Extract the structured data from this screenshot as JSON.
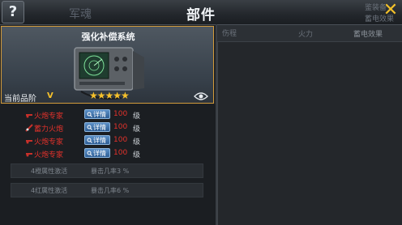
{
  "header": {
    "help_label": "?",
    "title": "部件",
    "close_label": "✕",
    "bg_text_left": "军魂",
    "bg_text_right_top": "鉴装备",
    "bg_text_right_bottom": "蓄电效果"
  },
  "bg_strip": {
    "t1": "伤程",
    "t2": "火力",
    "t3": "蓄电效果"
  },
  "card": {
    "title": "强化补偿系统",
    "grade_label": "当前品阶",
    "grade_value": "V",
    "stars": "★★★★★",
    "eye_icon": "eye-icon"
  },
  "parts": [
    {
      "icon": "cannon-icon",
      "name": "火炮专家",
      "detail": "详情",
      "level": "100",
      "unit": "级"
    },
    {
      "icon": "charge-cannon-icon",
      "name": "蓄力火炮",
      "detail": "详情",
      "level": "100",
      "unit": "级"
    },
    {
      "icon": "cannon-icon",
      "name": "火炮专家",
      "detail": "详情",
      "level": "100",
      "unit": "级"
    },
    {
      "icon": "cannon-icon",
      "name": "火炮专家",
      "detail": "详情",
      "level": "100",
      "unit": "级"
    }
  ],
  "attributes": [
    {
      "key": "4橙属性激活",
      "value": "暴击几率3 %"
    },
    {
      "key": "4红属性激活",
      "value": "暴击几率6 %"
    }
  ],
  "colors": {
    "accent": "#f6c12b",
    "red_text": "#e4322b",
    "border_gold": "#d29a3a"
  }
}
